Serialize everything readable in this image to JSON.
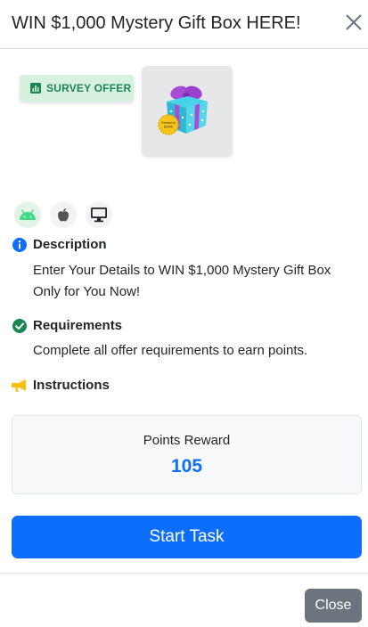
{
  "header": {
    "title": "WIN $1,000 Mystery Gift Box HERE!"
  },
  "offer": {
    "badge_label": "SURVEY OFFER",
    "badge_icon": "bar-chart-icon",
    "image_icon": "gift-box-icon",
    "image_sticker_text": "Reload at $1000"
  },
  "platforms": [
    {
      "name": "android-icon",
      "color": "#3ddc84"
    },
    {
      "name": "apple-icon",
      "color": "#555555"
    },
    {
      "name": "desktop-icon",
      "color": "#212529"
    }
  ],
  "sections": {
    "description": {
      "title": "Description",
      "text": "Enter Your Details to WIN $1,000 Mystery Gift Box Only for You Now!",
      "icon": "info-circle-icon",
      "icon_color": "#0d6efd"
    },
    "requirements": {
      "title": "Requirements",
      "text": "Complete all offer requirements to earn points.",
      "icon": "check-circle-icon",
      "icon_color": "#198754"
    },
    "instructions": {
      "title": "Instructions",
      "icon": "megaphone-icon",
      "icon_color": "#ffc107"
    }
  },
  "reward": {
    "label": "Points Reward",
    "value": "105"
  },
  "actions": {
    "start_label": "Start Task",
    "close_label": "Close"
  },
  "colors": {
    "primary": "#0d6efd",
    "success": "#198754",
    "secondary": "#6c757d",
    "warning": "#ffc107"
  }
}
